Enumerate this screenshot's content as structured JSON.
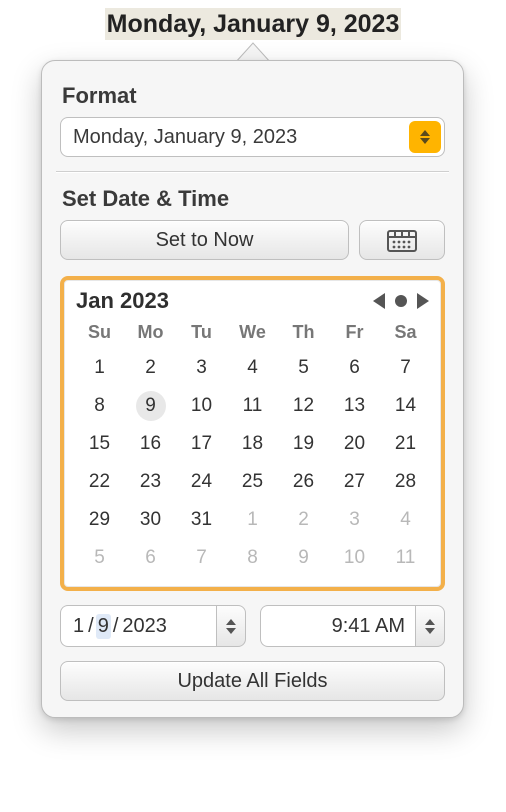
{
  "header": {
    "date": "Monday, January 9, 2023"
  },
  "format": {
    "label": "Format",
    "value": "Monday, January 9, 2023"
  },
  "setDateTime": {
    "label": "Set Date & Time",
    "setNow": "Set to Now",
    "updateAll": "Update All Fields"
  },
  "calendar": {
    "title": "Jan 2023",
    "weekdays": [
      "Su",
      "Mo",
      "Tu",
      "We",
      "Th",
      "Fr",
      "Sa"
    ],
    "selectedDay": 9,
    "rows": [
      [
        {
          "d": 1
        },
        {
          "d": 2
        },
        {
          "d": 3
        },
        {
          "d": 4
        },
        {
          "d": 5
        },
        {
          "d": 6
        },
        {
          "d": 7
        }
      ],
      [
        {
          "d": 8
        },
        {
          "d": 9,
          "sel": true
        },
        {
          "d": 10
        },
        {
          "d": 11
        },
        {
          "d": 12
        },
        {
          "d": 13
        },
        {
          "d": 14
        }
      ],
      [
        {
          "d": 15
        },
        {
          "d": 16
        },
        {
          "d": 17
        },
        {
          "d": 18
        },
        {
          "d": 19
        },
        {
          "d": 20
        },
        {
          "d": 21
        }
      ],
      [
        {
          "d": 22
        },
        {
          "d": 23
        },
        {
          "d": 24
        },
        {
          "d": 25
        },
        {
          "d": 26
        },
        {
          "d": 27
        },
        {
          "d": 28
        }
      ],
      [
        {
          "d": 29
        },
        {
          "d": 30
        },
        {
          "d": 31
        },
        {
          "d": 1,
          "other": true
        },
        {
          "d": 2,
          "other": true
        },
        {
          "d": 3,
          "other": true
        },
        {
          "d": 4,
          "other": true
        }
      ],
      [
        {
          "d": 5,
          "other": true
        },
        {
          "d": 6,
          "other": true
        },
        {
          "d": 7,
          "other": true
        },
        {
          "d": 8,
          "other": true
        },
        {
          "d": 9,
          "other": true
        },
        {
          "d": 10,
          "other": true
        },
        {
          "d": 11,
          "other": true
        }
      ]
    ]
  },
  "inputs": {
    "date": {
      "month": "1",
      "sep1": "/",
      "day": " 9",
      "sep2": "/",
      "year": "2023"
    },
    "time": "9:41 AM"
  },
  "colors": {
    "accent": "#ffb400",
    "calBorder": "#f3b04a"
  }
}
